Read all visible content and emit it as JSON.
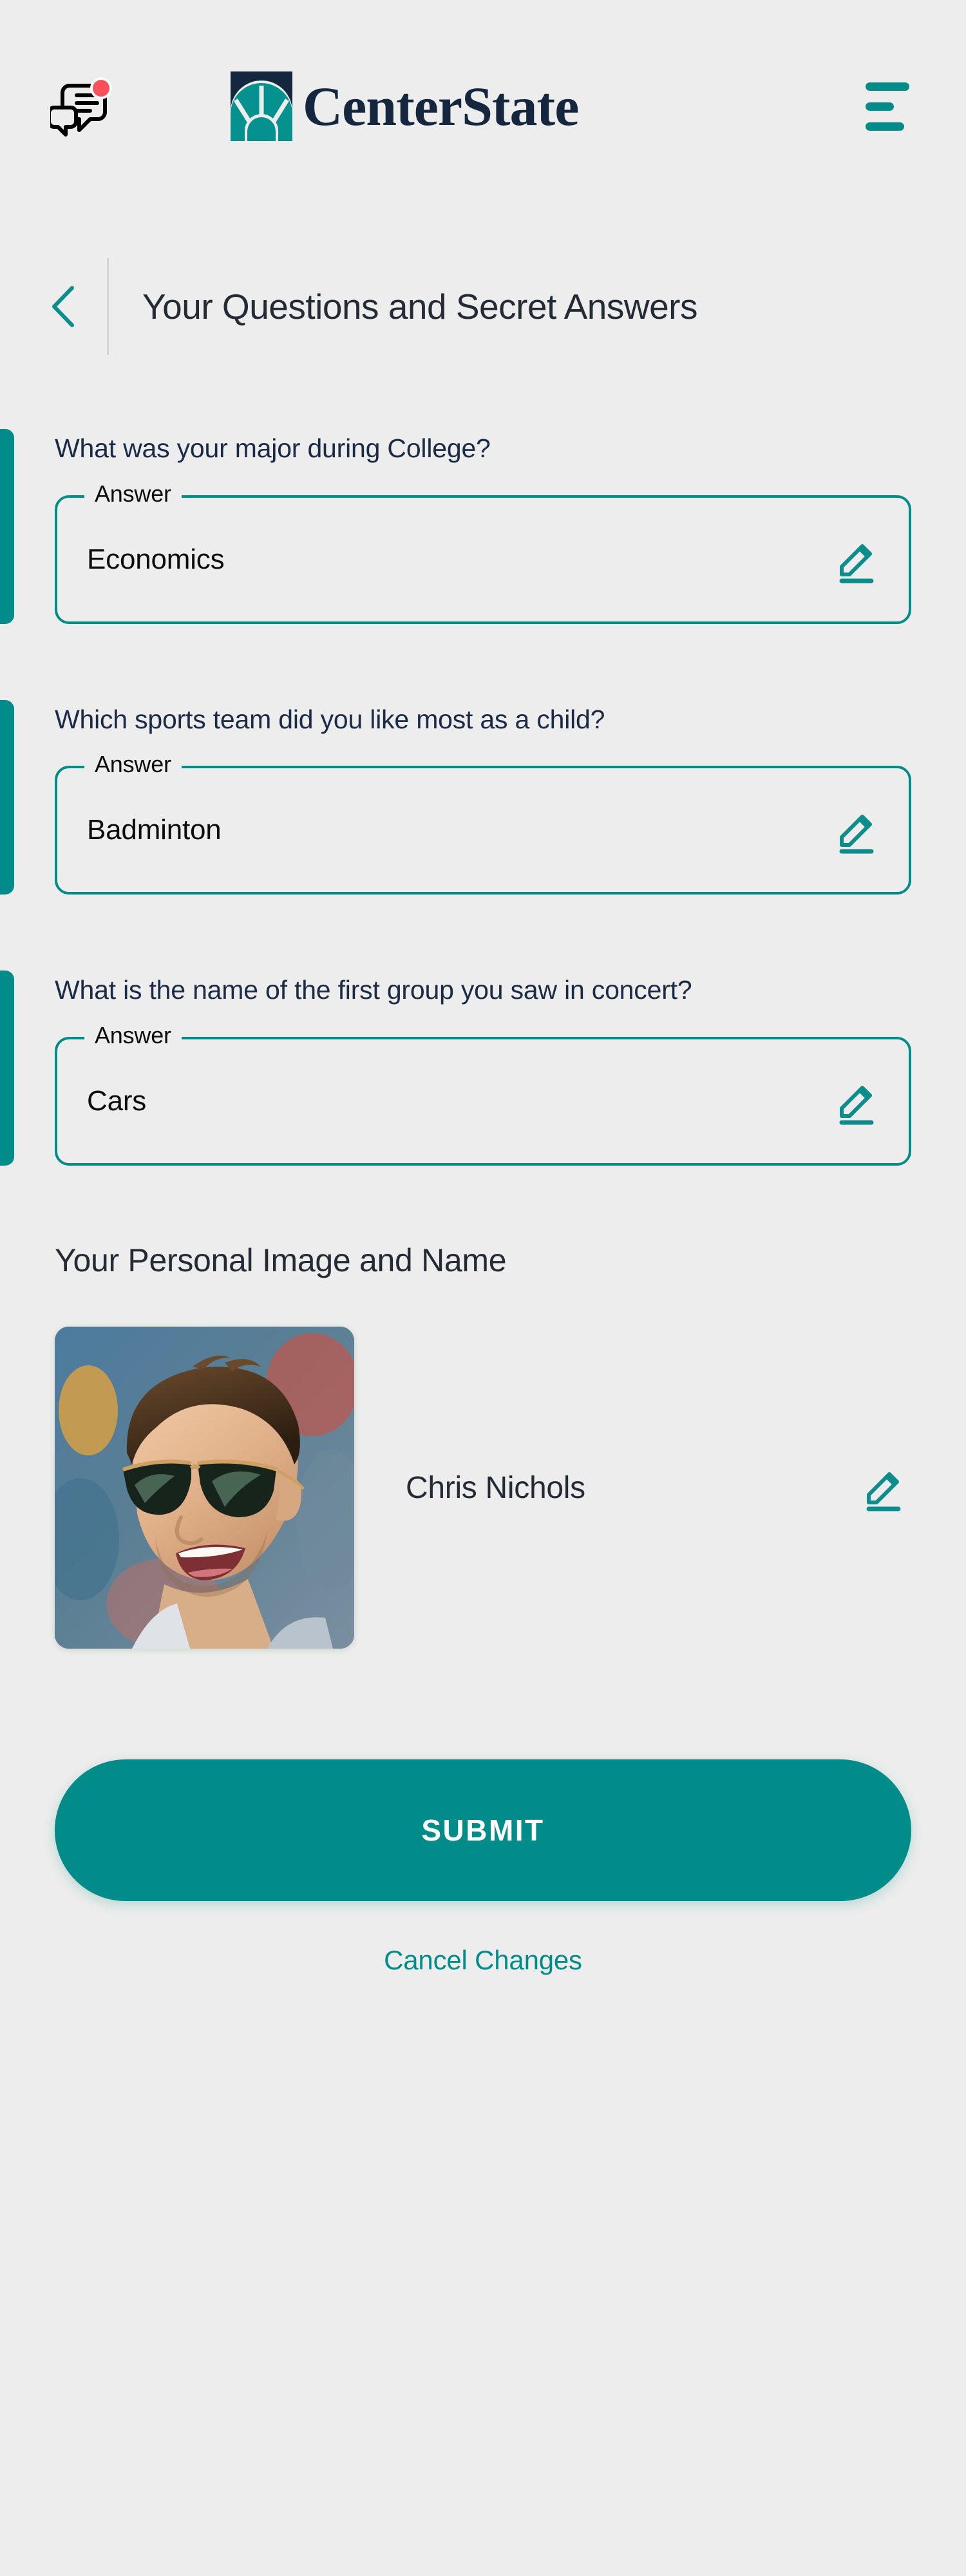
{
  "theme": {
    "background": "#ecedec",
    "accent_teal": "#028c89",
    "navy": "#1b2a45",
    "text_dark": "#242b35",
    "notification_red": "#fb5058",
    "white": "#ffffff"
  },
  "header": {
    "messages_icon": "messages-icon",
    "notification_badge": "notification-dot",
    "brand_name": "CenterState",
    "brand_mark": "centerstate-arch-logo",
    "menu_icon": "hamburger-menu-icon"
  },
  "page": {
    "back_icon": "chevron-left-icon",
    "title": "Your Questions and Secret Answers"
  },
  "questions": [
    {
      "question": "What was your major during College?",
      "answer_label": "Answer",
      "answer_value": "Economics",
      "edit_icon": "pencil-edit-icon"
    },
    {
      "question": "Which sports team did you like most as a child?",
      "answer_label": "Answer",
      "answer_value": "Badminton",
      "edit_icon": "pencil-edit-icon"
    },
    {
      "question": "What is the name of the first group you saw in concert?",
      "answer_label": "Answer",
      "answer_value": "Cars",
      "edit_icon": "pencil-edit-icon"
    }
  ],
  "personal": {
    "heading": "Your Personal Image and Name",
    "avatar_alt": "user-profile-photo",
    "name": "Chris Nichols",
    "edit_icon": "pencil-edit-icon"
  },
  "actions": {
    "submit_label": "SUBMIT",
    "cancel_label": "Cancel Changes"
  }
}
